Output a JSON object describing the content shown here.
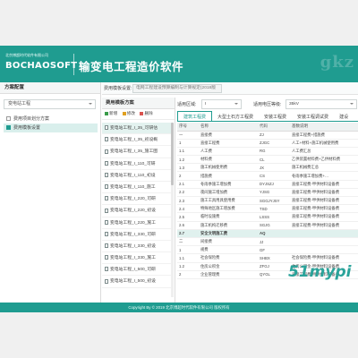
{
  "header": {
    "company": "北京博超时代软件有限公司",
    "logo_text": "BOCHAOSOFT",
    "app_title": "输变电工程造价软件",
    "watermark": "gkz"
  },
  "left_panel": {
    "title": "方案配置",
    "select_value": "变电站工程",
    "tree": [
      {
        "label": "费用项目划分方案",
        "selected": false
      },
      {
        "label": "费用模板设置",
        "selected": true
      }
    ]
  },
  "top_row": {
    "template_label": "费用模板设置:",
    "template_value": "电网工程建设预算编制与计算规定(2018版",
    "region_label": "适用区域:",
    "region_value": "I",
    "voltage_label": "适用电压等级:",
    "voltage_value": "35kV"
  },
  "mid_panel": {
    "title": "费用模板方案",
    "toolbar": {
      "new": "新增",
      "edit": "修改",
      "delete": "删除"
    },
    "items": [
      {
        "label": "变电站工程_I_35_可研估",
        "selected": true
      },
      {
        "label": "变电站工程_I_35_初设概",
        "selected": false
      },
      {
        "label": "变电站工程_I_35_施工图",
        "selected": false
      },
      {
        "label": "变电站工程_I_110_可研",
        "selected": false
      },
      {
        "label": "变电站工程_I_110_初设",
        "selected": false
      },
      {
        "label": "变电站工程_I_110_施工",
        "selected": false
      },
      {
        "label": "变电站工程_I_220_可研",
        "selected": false
      },
      {
        "label": "变电站工程_I_220_初设",
        "selected": false
      },
      {
        "label": "变电站工程_I_220_施工",
        "selected": false
      },
      {
        "label": "变电站工程_I_330_可研",
        "selected": false
      },
      {
        "label": "变电站工程_I_330_初设",
        "selected": false
      },
      {
        "label": "变电站工程_I_330_施工",
        "selected": false
      },
      {
        "label": "变电站工程_I_500_可研",
        "selected": false
      },
      {
        "label": "变电站工程_I_500_初设",
        "selected": false
      }
    ]
  },
  "tabs": [
    {
      "label": "建筑工程费",
      "active": true
    },
    {
      "label": "大型土石方工程费",
      "active": false
    },
    {
      "label": "安装工程费",
      "active": false
    },
    {
      "label": "安装工程调试费",
      "active": false
    },
    {
      "label": "建设",
      "active": false
    }
  ],
  "table": {
    "columns": [
      "序号",
      "名称",
      "代码",
      "基数说明"
    ],
    "rows": [
      {
        "cells": [
          "一",
          "直接费",
          "ZJ",
          "直接工程费+措施费"
        ],
        "selected": false,
        "bold": false
      },
      {
        "cells": [
          "1",
          "直接工程费",
          "ZJGC",
          "人工+材料+施工机械使用费"
        ],
        "selected": false,
        "bold": false
      },
      {
        "cells": [
          "1.1",
          "人工费",
          "RG",
          "人工费汇总"
        ],
        "selected": false,
        "bold": false
      },
      {
        "cells": [
          "1.2",
          "材料费",
          "CL",
          "乙供装置材料费+乙供材料费"
        ],
        "selected": false,
        "bold": false
      },
      {
        "cells": [
          "1.3",
          "施工机械使用费",
          "JX",
          "施工机械费汇总"
        ],
        "selected": false,
        "bold": false
      },
      {
        "cells": [
          "2",
          "措施费",
          "CS",
          "冬雨季施工增加费+…"
        ],
        "selected": false,
        "bold": false
      },
      {
        "cells": [
          "2.1",
          "冬雨季施工增加费",
          "DYJSZJ",
          "直接工程费-甲供材料设备费"
        ],
        "selected": false,
        "bold": false
      },
      {
        "cells": [
          "2.2",
          "夜间施工增加费",
          "YJSG",
          "直接工程费-甲供材料设备费"
        ],
        "selected": false,
        "bold": false
      },
      {
        "cells": [
          "2.3",
          "施工工具用具使用费",
          "SGGJYJSY",
          "直接工程费-甲供材料设备费"
        ],
        "selected": false,
        "bold": false
      },
      {
        "cells": [
          "2.4",
          "特殊地区施工增加费",
          "TSD",
          "直接工程费-甲供材料设备费"
        ],
        "selected": false,
        "bold": false
      },
      {
        "cells": [
          "2.5",
          "临时设施费",
          "LSSS",
          "直接工程费-甲供材料设备费"
        ],
        "selected": false,
        "bold": false
      },
      {
        "cells": [
          "2.6",
          "施工机构迁移费",
          "SGJG",
          "直接工程费-甲供材料设备费"
        ],
        "selected": false,
        "bold": false
      },
      {
        "cells": [
          "2.7",
          "安全文明施工费",
          "AQ",
          ""
        ],
        "selected": true,
        "bold": true
      },
      {
        "cells": [
          "二",
          "间接费",
          "JJ",
          ""
        ],
        "selected": false,
        "bold": false
      },
      {
        "cells": [
          "1",
          "规费",
          "GF",
          ""
        ],
        "selected": false,
        "bold": false
      },
      {
        "cells": [
          "1.1",
          "社会保险费",
          "SHBX",
          "社会保险费-甲供材料设备费"
        ],
        "selected": false,
        "bold": false
      },
      {
        "cells": [
          "1.2",
          "住房公积金",
          "ZFGJ",
          "住房公积金-甲供材料设备费"
        ],
        "selected": false,
        "bold": false
      },
      {
        "cells": [
          "2",
          "企业管理费",
          "QYGL",
          "直接工程费-甲供材料设备费"
        ],
        "selected": false,
        "bold": false
      }
    ]
  },
  "overlay_mark": "51mypi",
  "footer": "Copyright By © 2019 北京博超时代软件有限公司 版权所有"
}
